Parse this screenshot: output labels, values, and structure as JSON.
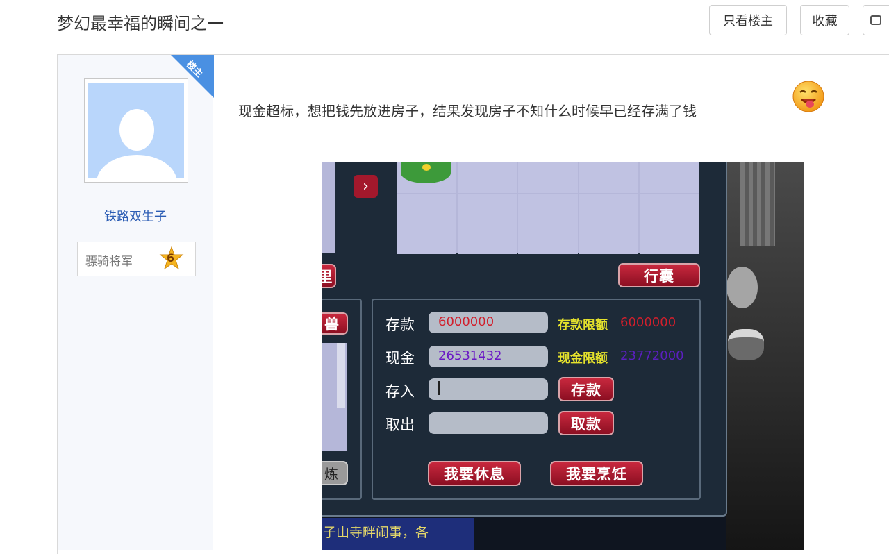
{
  "header": {
    "title": "梦幻最幸福的瞬间之一",
    "only_op_label": "只看楼主",
    "collect_label": "收藏"
  },
  "user": {
    "badge": "楼主",
    "name": "铁路双生子",
    "rank": "骠骑将军",
    "level": "6"
  },
  "post": {
    "text": "现金超标，想把钱先放进房子，结果发现房子不知什么时候早已经存满了钱"
  },
  "game": {
    "btn_bag": "行囊",
    "btn_li": "里",
    "btn_shou": "兽",
    "btn_grey": "炼",
    "deposit_label": "存款",
    "deposit_value": "6000000",
    "deposit_limit_label": "存款限额",
    "deposit_limit_value": "6000000",
    "cash_label": "现金",
    "cash_value": "26531432",
    "cash_limit_label": "现金限额",
    "cash_limit_value": "23772000",
    "put_label": "存入",
    "take_label": "取出",
    "btn_deposit": "存款",
    "btn_withdraw": "取款",
    "btn_rest": "我要休息",
    "btn_cook": "我要烹饪",
    "bottom_text": "子山寺畔闹事，各"
  },
  "colors": {
    "accent_blue": "#4a90e2",
    "link_blue": "#2c5db4",
    "game_red": "#d11f2c",
    "game_purple": "#6a18c4",
    "game_yellow": "#e5e22c"
  }
}
